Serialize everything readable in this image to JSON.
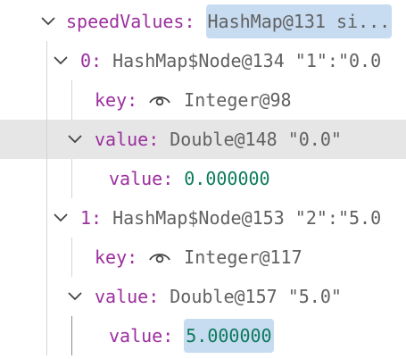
{
  "tree": {
    "speed_values": {
      "name": "speedValues",
      "value": "HashMap@131 si..."
    },
    "entry0": {
      "name": "0",
      "value": "HashMap$Node@134 \"1\":\"0.0",
      "key": {
        "name": "key",
        "icon": "eye-icon",
        "value": "Integer@98"
      },
      "value_node": {
        "name": "value",
        "value": "Double@148 \"0.0\"",
        "child": {
          "name": "value",
          "value": "0.000000"
        }
      }
    },
    "entry1": {
      "name": "1",
      "value": "HashMap$Node@153 \"2\":\"5.0",
      "key": {
        "name": "key",
        "icon": "eye-icon",
        "value": "Integer@117"
      },
      "value_node": {
        "name": "value",
        "value": "Double@157 \"5.0\"",
        "child": {
          "name": "value",
          "value": "5.000000"
        }
      }
    }
  },
  "colors": {
    "name": "#9b2f9e",
    "number": "#0b7a5a",
    "text": "#616161",
    "selection": "#e6e6e6",
    "highlight": "#c7dbf1"
  }
}
